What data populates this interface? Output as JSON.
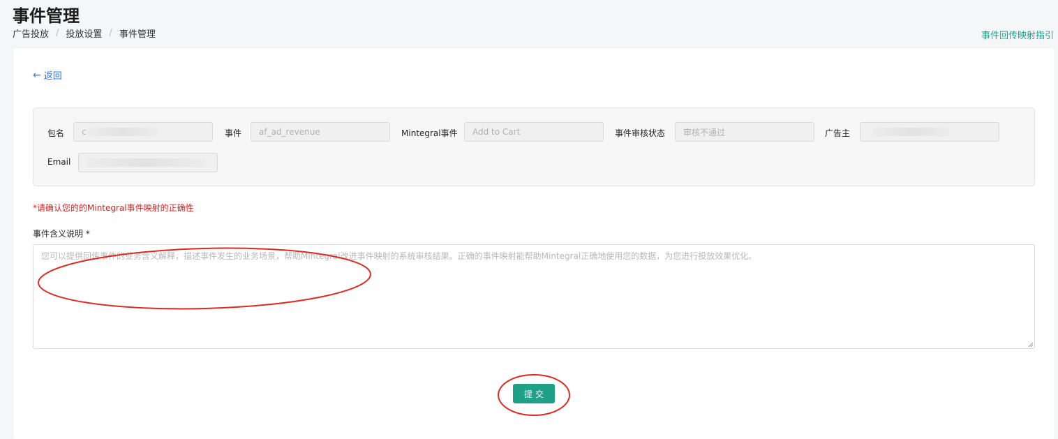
{
  "header": {
    "title": "事件管理",
    "breadcrumb": [
      "广告投放",
      "投放设置",
      "事件管理"
    ],
    "breadcrumb_separator": "/",
    "guide_link": "事件回传映射指引"
  },
  "back": {
    "arrow": "←",
    "label": "返回"
  },
  "info": {
    "package": {
      "label": "包名",
      "value": "c"
    },
    "event": {
      "label": "事件",
      "value": "af_ad_revenue"
    },
    "mintegral_event": {
      "label": "Mintegral事件",
      "value": "Add to Cart"
    },
    "review_status": {
      "label": "事件审核状态",
      "value": "审核不通过"
    },
    "advertiser": {
      "label": "广告主",
      "value": ""
    },
    "email": {
      "label": "Email",
      "value": ""
    }
  },
  "form": {
    "warning": "*请确认您的的Mintegral事件映射的正确性",
    "description_label": "事件含义说明 *",
    "description_placeholder": "您可以提供回传事件的业务含义解释，描述事件发生的业务场景，帮助Mintegral改进事件映射的系统审核结果。正确的事件映射能帮助Mintegral正确地使用您的数据，为您进行投放效果优化。",
    "submit_label": "提交"
  },
  "colors": {
    "accent": "#1fa187",
    "link": "#1677ff",
    "warning": "#e02020",
    "annotation": "#e0281f"
  }
}
